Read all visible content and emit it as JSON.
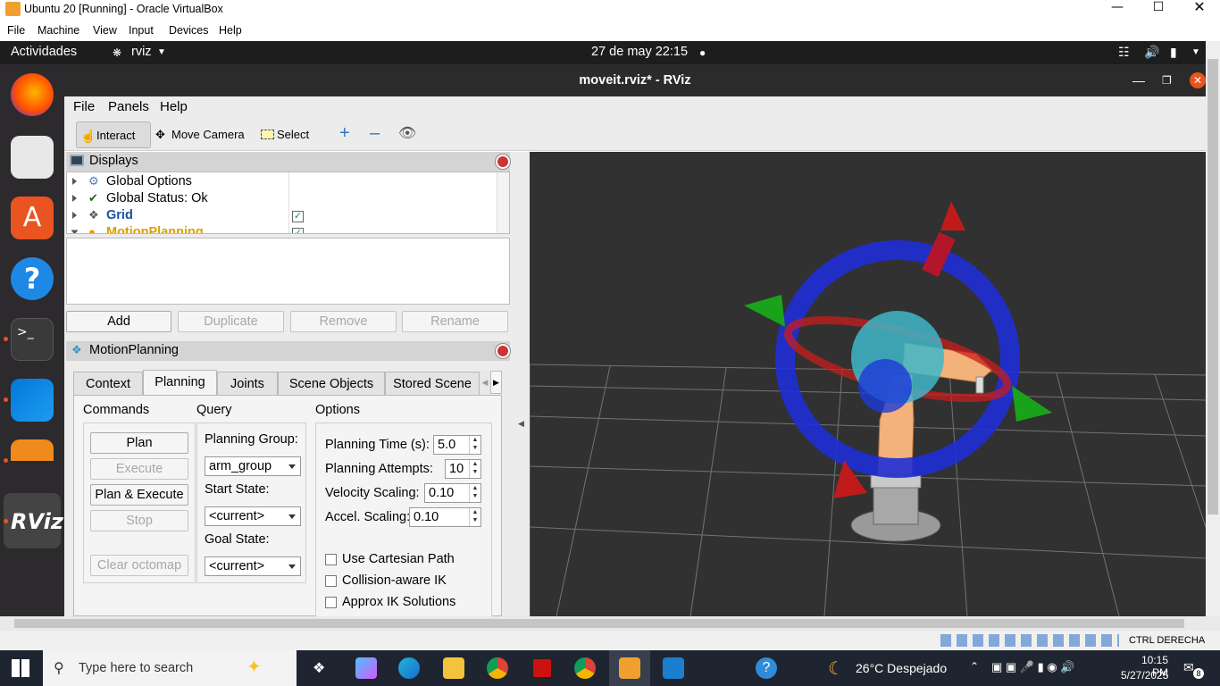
{
  "vbox": {
    "title": "Ubuntu 20 [Running] - Oracle VirtualBox",
    "menu": [
      "File",
      "Machine",
      "View",
      "Input",
      "Devices",
      "Help"
    ],
    "status_text": "CTRL DERECHA"
  },
  "ubuntu_bar": {
    "activities": "Actividades",
    "app": "rviz",
    "datetime": "27 de may  22:15"
  },
  "rviz": {
    "title": "moveit.rviz* - RViz",
    "menu": [
      "File",
      "Panels",
      "Help"
    ],
    "tools": {
      "interact": "Interact",
      "move_camera": "Move Camera",
      "select": "Select"
    },
    "displays": {
      "header": "Displays",
      "items": [
        {
          "label": "Global Options",
          "checked": null
        },
        {
          "label": "Global Status: Ok",
          "checked": null
        },
        {
          "label": "Grid",
          "checked": true
        },
        {
          "label": "MotionPlanning",
          "checked": true
        }
      ],
      "buttons": {
        "add": "Add",
        "duplicate": "Duplicate",
        "remove": "Remove",
        "rename": "Rename"
      }
    },
    "motion_planning": {
      "header": "MotionPlanning",
      "tabs": [
        "Context",
        "Planning",
        "Joints",
        "Scene Objects",
        "Stored Scene"
      ],
      "selected_tab": "Planning",
      "commands": {
        "label": "Commands",
        "plan": "Plan",
        "execute": "Execute",
        "plan_execute": "Plan & Execute",
        "stop": "Stop",
        "clear_octomap": "Clear octomap"
      },
      "query": {
        "label": "Query",
        "planning_group_label": "Planning Group:",
        "planning_group": "arm_group",
        "start_state_label": "Start State:",
        "start_state": "<current>",
        "goal_state_label": "Goal State:",
        "goal_state": "<current>"
      },
      "options": {
        "label": "Options",
        "planning_time_label": "Planning Time (s):",
        "planning_time": "5.0",
        "planning_attempts_label": "Planning Attempts:",
        "planning_attempts": "10",
        "velocity_label": "Velocity Scaling:",
        "velocity": "0.10",
        "accel_label": "Accel. Scaling:",
        "accel": "0.10",
        "cartesian": "Use Cartesian Path",
        "collision_ik": "Collision-aware IK",
        "approx_ik": "Approx IK Solutions"
      }
    }
  },
  "taskbar": {
    "search_placeholder": "Type here to search",
    "weather": "26°C  Despejado",
    "time": "10:15 PM",
    "date": "5/27/2025",
    "notif_count": "8"
  }
}
